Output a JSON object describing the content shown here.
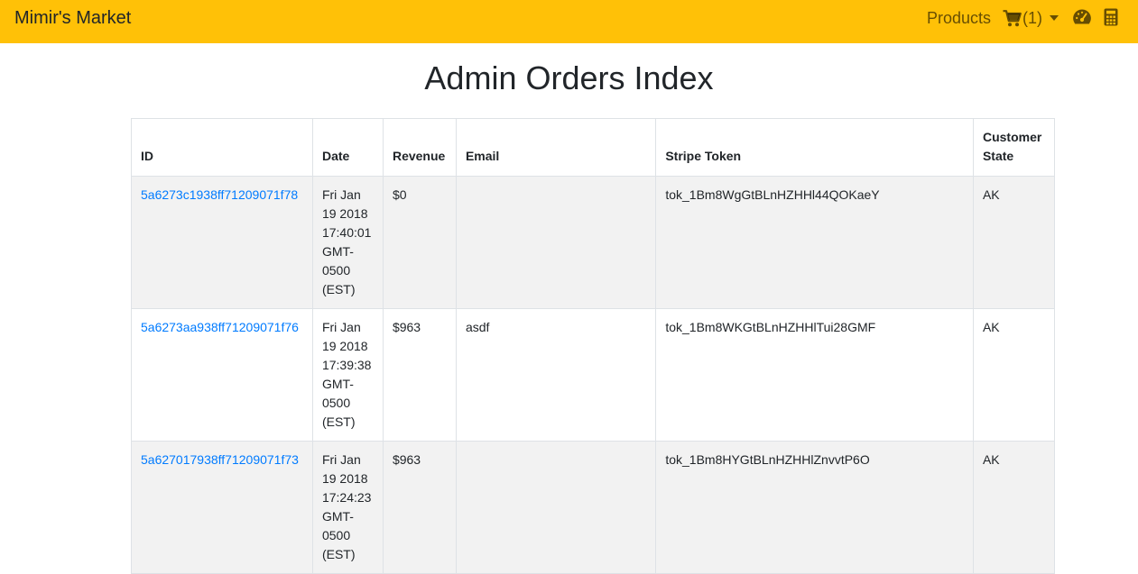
{
  "navbar": {
    "brand": "Mimir's Market",
    "products_label": "Products",
    "cart_count": "(1)",
    "icons": [
      "shopping-cart-icon",
      "dropdown-caret-icon",
      "dashboard-gauge-icon",
      "calculator-icon"
    ],
    "background_color": "#ffc107"
  },
  "page": {
    "title": "Admin Orders Index"
  },
  "table": {
    "headers": {
      "id": "ID",
      "date": "Date",
      "revenue": "Revenue",
      "email": "Email",
      "stripe_token": "Stripe Token",
      "customer_state": "Customer State"
    },
    "rows": [
      {
        "id": "5a6273c1938ff71209071f78",
        "date": "Fri Jan 19 2018 17:40:01 GMT-0500 (EST)",
        "revenue": "$0",
        "email": "",
        "stripe_token": "tok_1Bm8WgGtBLnHZHHl44QOKaeY",
        "customer_state": "AK"
      },
      {
        "id": "5a6273aa938ff71209071f76",
        "date": "Fri Jan 19 2018 17:39:38 GMT-0500 (EST)",
        "revenue": "$963",
        "email": "asdf",
        "stripe_token": "tok_1Bm8WKGtBLnHZHHlTui28GMF",
        "customer_state": "AK"
      },
      {
        "id": "5a627017938ff71209071f73",
        "date": "Fri Jan 19 2018 17:24:23 GMT-0500 (EST)",
        "revenue": "$963",
        "email": "",
        "stripe_token": "tok_1Bm8HYGtBLnHZHHlZnvvtP6O",
        "customer_state": "AK"
      }
    ],
    "link_color": "#007bff",
    "stripe_row_color": "#f2f2f2"
  }
}
